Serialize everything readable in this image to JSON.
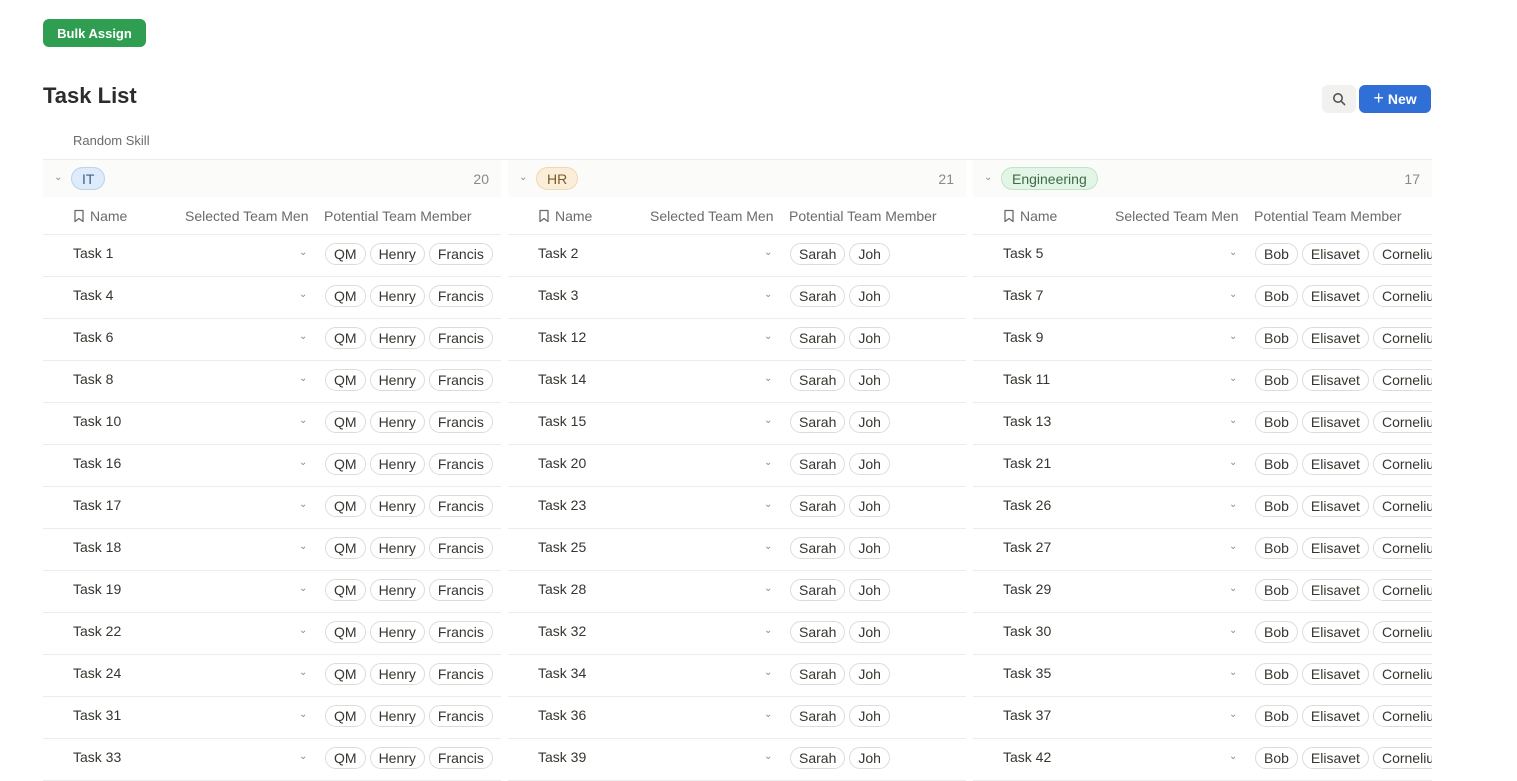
{
  "toolbar": {
    "bulk_assign_label": "Bulk Assign",
    "new_label": "New"
  },
  "page": {
    "title": "Task List",
    "view_label": "Random Skill"
  },
  "columns": {
    "name": "Name",
    "selected": "Selected Team Men",
    "potential": "Potential Team Member"
  },
  "colors": {
    "accent_green": "#2f9e50",
    "accent_blue": "#2f6fd6"
  },
  "icons": {
    "search": "search-icon",
    "plus": "plus-icon",
    "bookmark": "bookmark-icon",
    "chevron": "chevron-down-icon"
  },
  "groups": [
    {
      "tag": "IT",
      "count": "20",
      "tag_bg": "#ddebfa",
      "tag_border": "#b9d3f0",
      "tag_color": "#3b5f8a",
      "members": [
        "QM",
        "Henry",
        "Francis"
      ],
      "tasks": [
        "Task 1",
        "Task 4",
        "Task 6",
        "Task 8",
        "Task 10",
        "Task 16",
        "Task 17",
        "Task 18",
        "Task 19",
        "Task 22",
        "Task 24",
        "Task 31",
        "Task 33"
      ]
    },
    {
      "tag": "HR",
      "count": "21",
      "tag_bg": "#fbeed9",
      "tag_border": "#f0d9b0",
      "tag_color": "#7a5b2a",
      "members": [
        "Sarah",
        "Joh"
      ],
      "tasks": [
        "Task 2",
        "Task 3",
        "Task 12",
        "Task 14",
        "Task 15",
        "Task 20",
        "Task 23",
        "Task 25",
        "Task 28",
        "Task 32",
        "Task 34",
        "Task 36",
        "Task 39"
      ]
    },
    {
      "tag": "Engineering",
      "count": "17",
      "tag_bg": "#e3f5e6",
      "tag_border": "#bfe5c6",
      "tag_color": "#3d6b45",
      "members": [
        "Bob",
        "Elisavet",
        "Corneliu"
      ],
      "tasks": [
        "Task 5",
        "Task 7",
        "Task 9",
        "Task 11",
        "Task 13",
        "Task 21",
        "Task 26",
        "Task 27",
        "Task 29",
        "Task 30",
        "Task 35",
        "Task 37",
        "Task 42"
      ]
    }
  ]
}
